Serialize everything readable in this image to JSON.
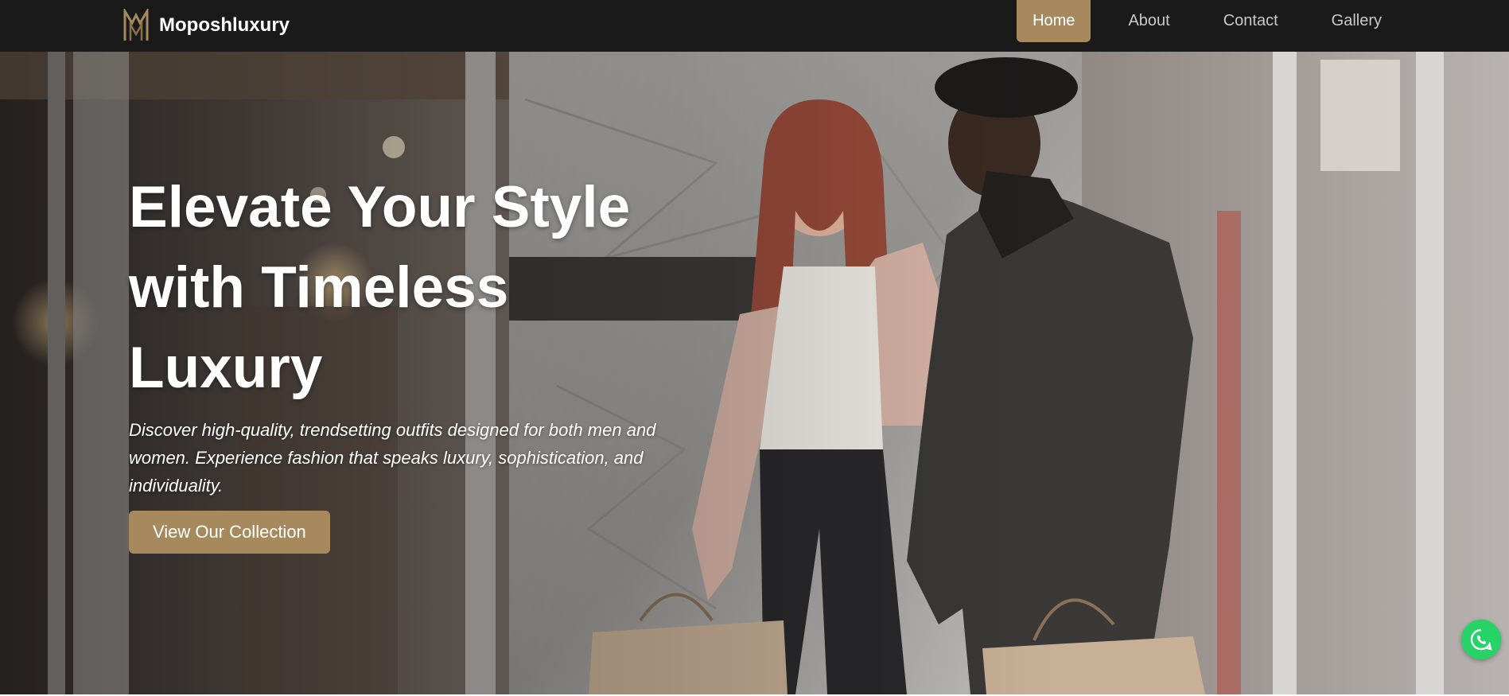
{
  "brand": {
    "name": "Moposhluxury",
    "logo_icon": "mm-monogram-icon",
    "color": "#a68a5e"
  },
  "nav": {
    "items": [
      {
        "label": "Home",
        "active": true
      },
      {
        "label": "About",
        "active": false
      },
      {
        "label": "Contact",
        "active": false
      },
      {
        "label": "Gallery",
        "active": false
      }
    ],
    "background": "#1a1a1a",
    "active_color": "#a68a5e"
  },
  "hero": {
    "title_lines": [
      "Elevate Your Style",
      "with Timeless",
      "Luxury"
    ],
    "subtitle": "Discover high-quality, trendsetting outfits designed for both men and women. Experience fashion that speaks luxury, sophistication, and individuality.",
    "cta_label": "View Our Collection",
    "background_image": "couple-shopping-photo"
  },
  "whatsapp": {
    "icon": "whatsapp-icon",
    "color": "#25d366"
  }
}
